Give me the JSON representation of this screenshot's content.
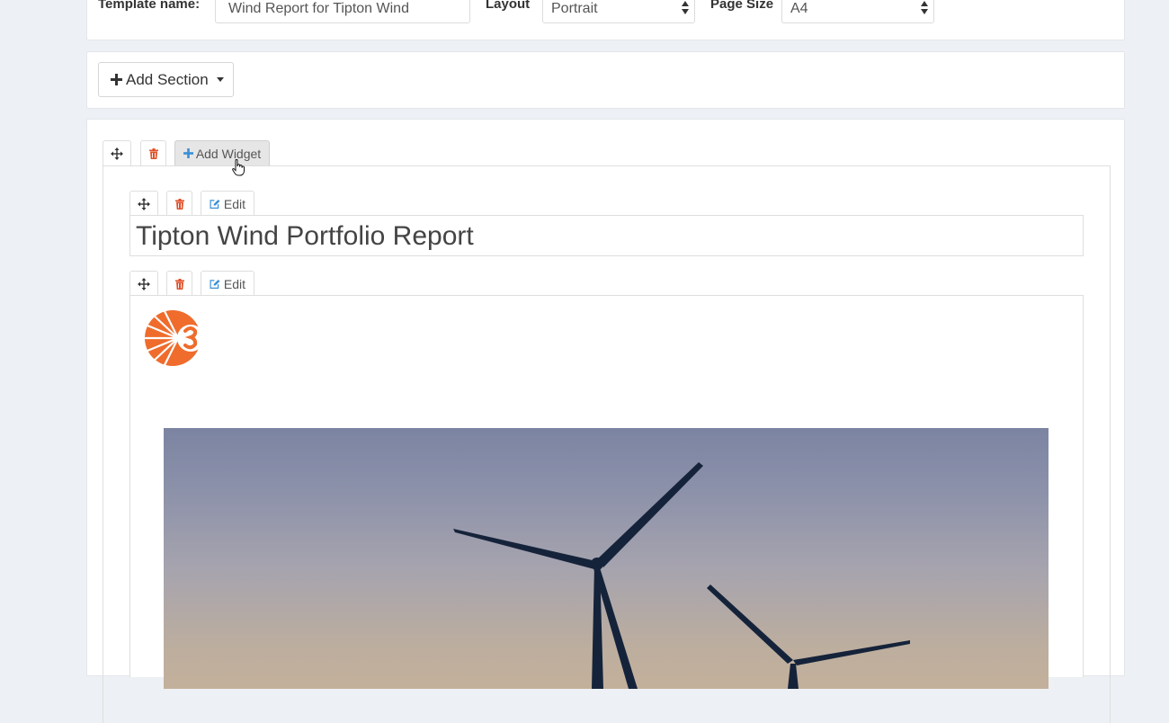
{
  "settings": {
    "template_name_label": "Template name:",
    "template_name_value": "Wind Report for Tipton Wind",
    "layout_label": "Layout",
    "layout_value": "Portrait",
    "page_size_label": "Page Size",
    "page_size_value": "A4"
  },
  "toolbar": {
    "add_section_label": "Add Section",
    "add_widget_label": "Add Widget",
    "edit_label": "Edit"
  },
  "widgets": {
    "title_text": "Tipton Wind Portfolio Report"
  },
  "icons": {
    "move": "move-arrows-icon",
    "delete": "trash-icon",
    "edit": "pencil-square-icon",
    "add": "plus-icon",
    "caret": "caret-down-icon",
    "cursor": "hand-pointer-icon"
  },
  "colors": {
    "page_bg": "#edf0f4",
    "delete_icon": "#e0522b",
    "accent_blue": "#3a8fd6",
    "logo_orange": "#ef6c2c"
  }
}
